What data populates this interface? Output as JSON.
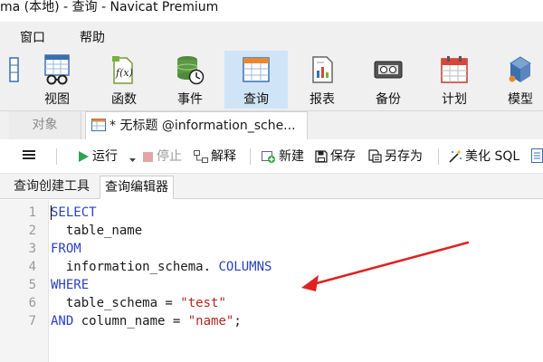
{
  "window": {
    "title": "ma (本地) - 查询 - Navicat Premium"
  },
  "menubar": {
    "items": [
      "窗口",
      "帮助"
    ]
  },
  "ribbon": {
    "items": [
      {
        "label": "视图",
        "icon": "view-icon"
      },
      {
        "label": "函数",
        "icon": "function-icon"
      },
      {
        "label": "事件",
        "icon": "event-icon"
      },
      {
        "label": "查询",
        "icon": "query-icon",
        "active": true
      },
      {
        "label": "报表",
        "icon": "report-icon"
      },
      {
        "label": "备份",
        "icon": "backup-icon"
      },
      {
        "label": "计划",
        "icon": "schedule-icon"
      },
      {
        "label": "模型",
        "icon": "model-icon"
      }
    ]
  },
  "tabs": {
    "object": "对象",
    "query": "* 无标题 @information_sche..."
  },
  "toolbar": {
    "run": "运行",
    "stop": "停止",
    "explain": "解释",
    "new": "新建",
    "save": "保存",
    "save_as": "另存为",
    "beautify": "美化 SQL"
  },
  "subtabs": {
    "builder": "查询创建工具",
    "editor": "查询编辑器"
  },
  "editor": {
    "line_numbers": [
      "1",
      "2",
      "3",
      "4",
      "5",
      "6",
      "7"
    ],
    "lines": [
      {
        "kw1": "SELECT"
      },
      {
        "text": "  table_name"
      },
      {
        "kw1": "FROM"
      },
      {
        "text": "  information_schema. ",
        "kw2": "COLUMNS"
      },
      {
        "kw1": "WHERE"
      },
      {
        "text": "  table_schema = ",
        "str": "\"test\""
      },
      {
        "kw1": "AND",
        "text": " column_name = ",
        "str": "\"name\"",
        "tail": ";"
      }
    ]
  },
  "colors": {
    "keyword": "#2b3fbf",
    "string": "#b3261e",
    "arrow": "#e02020",
    "active_ribbon": "#cfe5f7"
  }
}
